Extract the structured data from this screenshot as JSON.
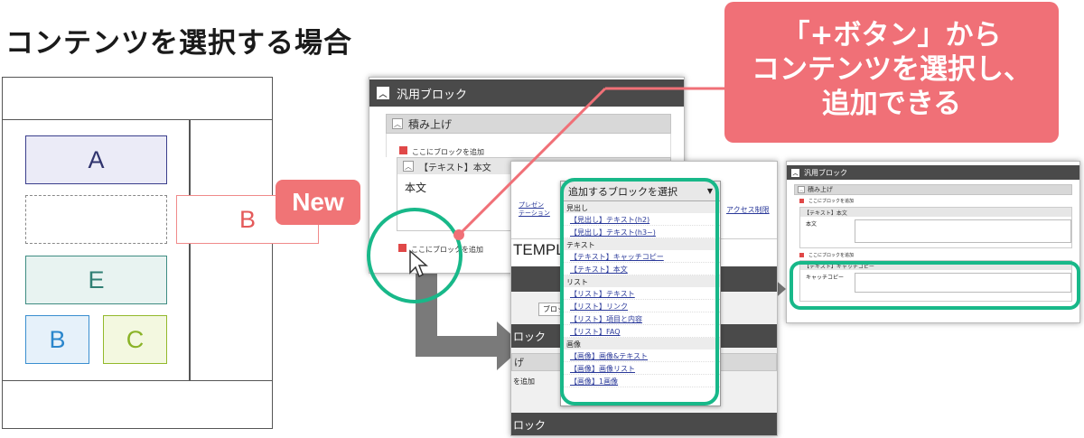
{
  "title": "コンテンツを選択する場合",
  "wireframe": {
    "blocks": {
      "a": "A",
      "e": "E",
      "b": "B",
      "c": "C",
      "new_b": "B"
    },
    "new_badge": "New"
  },
  "callout": {
    "line1": "「+ボタン」から",
    "line2": "コンテンツを選択し、",
    "line3": "追加できる"
  },
  "screenshot1": {
    "header": "汎用ブロック",
    "stack_bar": "積み上げ",
    "add_block_link": "ここにブロックを追加",
    "text_block_bar": "【テキスト】本文",
    "body_label": "本文",
    "add_block_link2": "ここにブロックを追加"
  },
  "screenshot2": {
    "tab_present": "プレゼン\nテーション",
    "tab_access": "アクセス制限",
    "template": "TEMPL",
    "block_btn": "ブロック",
    "block_label1": "ロック",
    "block_label2": "げ",
    "block_label3": "を追加",
    "block_label4": "ロック"
  },
  "popup": {
    "header": "追加するブロックを選択",
    "groups": [
      {
        "cat": "見出し",
        "items": [
          "【見出し】テキスト(h2)",
          "【見出し】テキスト(h3~)"
        ]
      },
      {
        "cat": "テキスト",
        "items": [
          "【テキスト】キャッチコピー",
          "【テキスト】本文"
        ]
      },
      {
        "cat": "リスト",
        "items": [
          "【リスト】テキスト",
          "【リスト】リンク",
          "【リスト】項目と内容",
          "【リスト】FAQ"
        ]
      },
      {
        "cat": "画像",
        "items": [
          "【画像】画像&テキスト",
          "【画像】画像リスト",
          "【画像】1画像"
        ]
      }
    ]
  },
  "screenshot3": {
    "header": "汎用ブロック",
    "stack_bar": "積み上げ",
    "add_link": "ここにブロックを追加",
    "text_block_bar": "【テキスト】本文",
    "body_label": "本文",
    "add_link2": "ここにブロックを追加",
    "catch_bar": "【テキスト】キャッチコピー",
    "catch_label": "キャッチコピー"
  },
  "colors": {
    "callout": "#f07077",
    "highlight": "#18b889",
    "arrow": "#7a7a7a"
  }
}
